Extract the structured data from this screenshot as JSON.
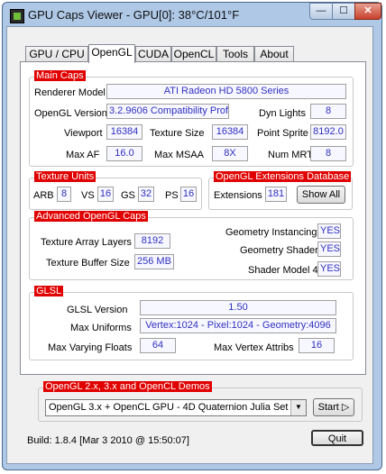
{
  "window": {
    "title": "GPU Caps Viewer - GPU[0]: 38°C/101°F",
    "min_label": "—",
    "max_label": "☐",
    "close_label": "✕"
  },
  "tabs": [
    {
      "label": "GPU / CPU"
    },
    {
      "label": "OpenGL"
    },
    {
      "label": "CUDA"
    },
    {
      "label": "OpenCL"
    },
    {
      "label": "Tools"
    },
    {
      "label": "About"
    }
  ],
  "main_caps": {
    "title": "Main Caps",
    "renderer_model_label": "Renderer Model",
    "renderer_model": "ATI Radeon HD 5800 Series",
    "opengl_version_label": "OpenGL Version",
    "opengl_version": "3.2.9606 Compatibility Profile",
    "dyn_lights_label": "Dyn Lights",
    "dyn_lights": "8",
    "viewport_label": "Viewport",
    "viewport": "16384",
    "texture_size_label": "Texture Size",
    "texture_size": "16384",
    "point_sprite_label": "Point Sprite",
    "point_sprite": "8192.0",
    "max_af_label": "Max AF",
    "max_af": "16.0",
    "max_msaa_label": "Max MSAA",
    "max_msaa": "8X",
    "num_mrt_label": "Num MRT",
    "num_mrt": "8"
  },
  "texture_units": {
    "title": "Texture Units",
    "arb_label": "ARB",
    "arb": "8",
    "vs_label": "VS",
    "vs": "16",
    "gs_label": "GS",
    "gs": "32",
    "ps_label": "PS",
    "ps": "16"
  },
  "extensions_db": {
    "title": "OpenGL Extensions Database",
    "extensions_label": "Extensions",
    "extensions": "181",
    "show_all_label": "Show All"
  },
  "advanced_caps": {
    "title": "Advanced OpenGL Caps",
    "texture_array_layers_label": "Texture Array Layers",
    "texture_array_layers": "8192",
    "texture_buffer_size_label": "Texture Buffer Size",
    "texture_buffer_size": "256 MB",
    "geometry_instancing_label": "Geometry Instancing",
    "geometry_instancing": "YES",
    "geometry_shader_label": "Geometry Shader",
    "geometry_shader": "YES",
    "shader_model_4_label": "Shader Model 4",
    "shader_model_4": "YES"
  },
  "glsl": {
    "title": "GLSL",
    "glsl_version_label": "GLSL Version",
    "glsl_version": "1.50",
    "max_uniforms_label": "Max Uniforms",
    "max_uniforms": "Vertex:1024  -  Pixel:1024  -  Geometry:4096",
    "max_varying_floats_label": "Max Varying Floats",
    "max_varying_floats": "64",
    "max_vertex_attribs_label": "Max Vertex Attribs",
    "max_vertex_attribs": "16"
  },
  "demos": {
    "title": "OpenGL 2.x, 3.x and OpenCL Demos",
    "selected_demo": "OpenGL 3.x + OpenCL GPU - 4D Quaternion Julia Set",
    "start_label": "Start ▷"
  },
  "status": {
    "build": "Build: 1.8.4 [Mar  3 2010 @ 15:50:07]"
  },
  "quit_label": "Quit",
  "colors": {
    "group_title_bg": "#e00000",
    "value_text": "#3030c0",
    "window_frame": "#aec8e6"
  }
}
